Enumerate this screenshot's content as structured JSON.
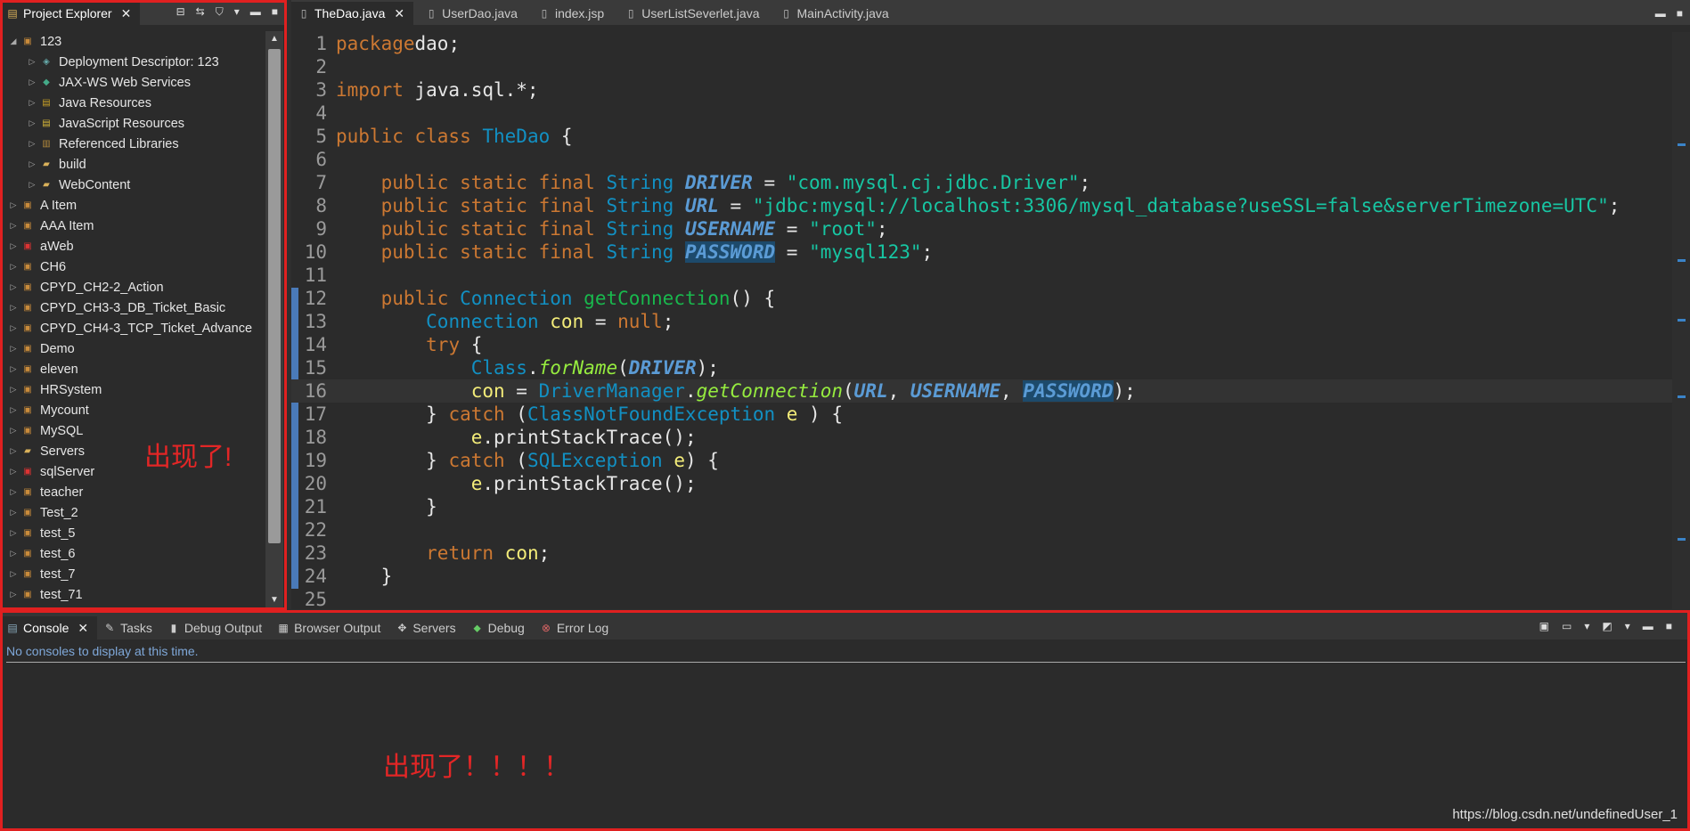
{
  "project_explorer": {
    "tab_label": "Project Explorer",
    "annotation": "出现了!",
    "tree": [
      {
        "label": "123",
        "indent": 0,
        "expanded": true,
        "icon": "project-icon"
      },
      {
        "label": "Deployment Descriptor: 123",
        "indent": 1,
        "icon": "descriptor-icon"
      },
      {
        "label": "JAX-WS Web Services",
        "indent": 1,
        "icon": "webservices-icon"
      },
      {
        "label": "Java Resources",
        "indent": 1,
        "icon": "java-resources-icon"
      },
      {
        "label": "JavaScript Resources",
        "indent": 1,
        "icon": "js-resources-icon"
      },
      {
        "label": "Referenced Libraries",
        "indent": 1,
        "icon": "library-icon"
      },
      {
        "label": "build",
        "indent": 1,
        "icon": "folder-icon"
      },
      {
        "label": "WebContent",
        "indent": 1,
        "icon": "folder-icon"
      },
      {
        "label": "A Item",
        "indent": 0,
        "icon": "project-icon"
      },
      {
        "label": "AAA Item",
        "indent": 0,
        "icon": "project-icon"
      },
      {
        "label": "aWeb",
        "indent": 0,
        "icon": "project-error-icon"
      },
      {
        "label": "CH6",
        "indent": 0,
        "icon": "project-icon"
      },
      {
        "label": "CPYD_CH2-2_Action",
        "indent": 0,
        "icon": "project-icon"
      },
      {
        "label": "CPYD_CH3-3_DB_Ticket_Basic",
        "indent": 0,
        "icon": "project-icon"
      },
      {
        "label": "CPYD_CH4-3_TCP_Ticket_Advance",
        "indent": 0,
        "icon": "project-icon"
      },
      {
        "label": "Demo",
        "indent": 0,
        "icon": "project-icon"
      },
      {
        "label": "eleven",
        "indent": 0,
        "icon": "project-icon"
      },
      {
        "label": "HRSystem",
        "indent": 0,
        "icon": "project-icon"
      },
      {
        "label": "Mycount",
        "indent": 0,
        "icon": "project-icon"
      },
      {
        "label": "MySQL",
        "indent": 0,
        "icon": "project-icon"
      },
      {
        "label": "Servers",
        "indent": 0,
        "icon": "folder-icon"
      },
      {
        "label": "sqlServer",
        "indent": 0,
        "icon": "project-error-icon"
      },
      {
        "label": "teacher",
        "indent": 0,
        "icon": "project-icon"
      },
      {
        "label": "Test_2",
        "indent": 0,
        "icon": "project-icon"
      },
      {
        "label": "test_5",
        "indent": 0,
        "icon": "project-icon"
      },
      {
        "label": "test_6",
        "indent": 0,
        "icon": "project-icon"
      },
      {
        "label": "test_7",
        "indent": 0,
        "icon": "project-icon"
      },
      {
        "label": "test_71",
        "indent": 0,
        "icon": "project-icon"
      }
    ]
  },
  "editor": {
    "tabs": [
      "TheDao.java",
      "UserDao.java",
      "index.jsp",
      "UserListSeverlet.java",
      "MainActivity.java"
    ],
    "active_tab": 0,
    "current_line": 16,
    "lines": [
      [
        [
          "k",
          "package"
        ],
        [
          "",
          "dao;"
        ]
      ],
      [],
      [
        [
          "k",
          "import"
        ],
        [
          "",
          " java.sql.*;"
        ]
      ],
      [],
      [
        [
          "k",
          "public class "
        ],
        [
          "t",
          "TheDao"
        ],
        [
          "",
          " {"
        ]
      ],
      [],
      [
        [
          "",
          "    "
        ],
        [
          "k",
          "public static final "
        ],
        [
          "t",
          "String "
        ],
        [
          "cst",
          "DRIVER"
        ],
        [
          "",
          " = "
        ],
        [
          "s",
          "\"com.mysql.cj.jdbc.Driver\""
        ],
        [
          "",
          ";"
        ]
      ],
      [
        [
          "",
          "    "
        ],
        [
          "k",
          "public static final "
        ],
        [
          "t",
          "String "
        ],
        [
          "cst",
          "URL"
        ],
        [
          "",
          " = "
        ],
        [
          "s",
          "\"jdbc:mysql://localhost:3306/mysql_database?useSSL=false&serverTimezone=UTC\""
        ],
        [
          "",
          ";"
        ]
      ],
      [
        [
          "",
          "    "
        ],
        [
          "k",
          "public static final "
        ],
        [
          "t",
          "String "
        ],
        [
          "cst",
          "USERNAME"
        ],
        [
          "",
          " = "
        ],
        [
          "s",
          "\"root\""
        ],
        [
          "",
          ";"
        ]
      ],
      [
        [
          "",
          "    "
        ],
        [
          "k",
          "public static final "
        ],
        [
          "t",
          "String "
        ],
        [
          "cst hl",
          "PASSWORD"
        ],
        [
          "",
          " = "
        ],
        [
          "s",
          "\"mysql123\""
        ],
        [
          "",
          ";"
        ]
      ],
      [],
      [
        [
          "",
          "    "
        ],
        [
          "k",
          "public "
        ],
        [
          "t",
          "Connection "
        ],
        [
          "fn",
          "getConnection"
        ],
        [
          "",
          "() {"
        ]
      ],
      [
        [
          "",
          "        "
        ],
        [
          "t",
          "Connection "
        ],
        [
          "var",
          "con"
        ],
        [
          "",
          " = "
        ],
        [
          "k",
          "null"
        ],
        [
          "",
          ";"
        ]
      ],
      [
        [
          "",
          "        "
        ],
        [
          "k",
          "try"
        ],
        [
          "",
          " {"
        ]
      ],
      [
        [
          "",
          "            "
        ],
        [
          "t",
          "Class"
        ],
        [
          "",
          "."
        ],
        [
          "mi",
          "forName"
        ],
        [
          "",
          "("
        ],
        [
          "cst",
          "DRIVER"
        ],
        [
          "",
          ");"
        ]
      ],
      [
        [
          "",
          "            "
        ],
        [
          "var",
          "con"
        ],
        [
          "",
          " = "
        ],
        [
          "t",
          "DriverManager"
        ],
        [
          "",
          "."
        ],
        [
          "mi",
          "getConnection"
        ],
        [
          "",
          "("
        ],
        [
          "cst",
          "URL"
        ],
        [
          "",
          ", "
        ],
        [
          "cst",
          "USERNAME"
        ],
        [
          "",
          ", "
        ],
        [
          "cst hl",
          "PASSWORD"
        ],
        [
          "",
          ");"
        ]
      ],
      [
        [
          "",
          "        } "
        ],
        [
          "k",
          "catch"
        ],
        [
          "",
          " ("
        ],
        [
          "t",
          "ClassNotFoundException "
        ],
        [
          "var",
          "e"
        ],
        [
          "",
          " ) {"
        ]
      ],
      [
        [
          "",
          "            "
        ],
        [
          "var",
          "e"
        ],
        [
          "",
          ".printStackTrace();"
        ]
      ],
      [
        [
          "",
          "        } "
        ],
        [
          "k",
          "catch"
        ],
        [
          "",
          " ("
        ],
        [
          "t",
          "SQLException "
        ],
        [
          "var",
          "e"
        ],
        [
          "",
          ") {"
        ]
      ],
      [
        [
          "",
          "            "
        ],
        [
          "var",
          "e"
        ],
        [
          "",
          ".printStackTrace();"
        ]
      ],
      [
        [
          "",
          "        }"
        ]
      ],
      [],
      [
        [
          "",
          "        "
        ],
        [
          "k",
          "return "
        ],
        [
          "var",
          "con"
        ],
        [
          "",
          ";"
        ]
      ],
      [
        [
          "",
          "    }"
        ]
      ],
      []
    ]
  },
  "console": {
    "tabs": [
      {
        "label": "Console",
        "icon": "console-icon"
      },
      {
        "label": "Tasks",
        "icon": "tasks-icon"
      },
      {
        "label": "Debug Output",
        "icon": "debug-output-icon"
      },
      {
        "label": "Browser Output",
        "icon": "browser-output-icon"
      },
      {
        "label": "Servers",
        "icon": "servers-icon"
      },
      {
        "label": "Debug",
        "icon": "debug-icon"
      },
      {
        "label": "Error Log",
        "icon": "error-log-icon"
      }
    ],
    "message": "No consoles to display at this time.",
    "annotation": "出现了！！！！",
    "watermark": "https://blog.csdn.net/undefinedUser_1"
  },
  "colors": {
    "annotation_red": "#e02020",
    "keyword": "#cc7832",
    "type": "#1290c3",
    "string": "#17c6a3"
  }
}
